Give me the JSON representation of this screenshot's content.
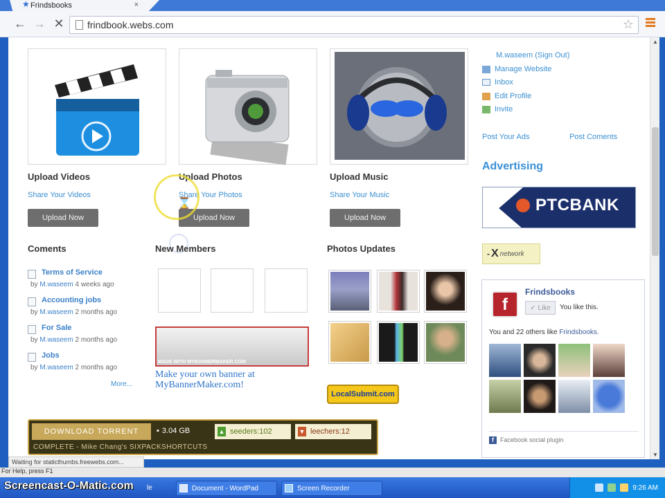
{
  "browser": {
    "tab_title": "Frindsbooks",
    "tab_close": "×",
    "url": "frindbook.webs.com",
    "back_glyph": "←",
    "forward_glyph": "→",
    "reload_glyph": "✕",
    "bookmark_glyph": "☆",
    "status_text": "Waiting for staticthumbs.freewebs.com..."
  },
  "uploads": [
    {
      "title": "Upload Videos",
      "share": "Share Your Videos",
      "button": "Upload Now",
      "icon": "clapperboard-icon"
    },
    {
      "title": "Upload Photos",
      "share": "Share Your Photos",
      "button": "Upload Now",
      "icon": "camera-icon"
    },
    {
      "title": "Upload Music",
      "share": "Share Your Music",
      "button": "Upload Now",
      "icon": "headphones-icon"
    }
  ],
  "user_menu": {
    "user": "M.waseem",
    "sign_out": "(Sign Out)",
    "items": [
      "Manage Website",
      "Inbox",
      "Edit Profile",
      "Invite"
    ],
    "post_ads": "Post Your Ads",
    "post_comments": "Post Coments"
  },
  "advertising": {
    "heading": "Advertising",
    "banner_text": "PTCBANK",
    "network_text": "network"
  },
  "comments": {
    "heading": "Coments",
    "items": [
      {
        "title": "Terms of Service",
        "by": "by",
        "author": "M.waseem",
        "when": "4 weeks ago"
      },
      {
        "title": "Accounting jobs",
        "by": "by",
        "author": "M.waseem",
        "when": "2 months ago"
      },
      {
        "title": "For Sale",
        "by": "by",
        "author": "M.waseem",
        "when": "2 months ago"
      },
      {
        "title": "Jobs",
        "by": "by",
        "author": "M.waseem",
        "when": "2 months ago"
      }
    ],
    "more": "More..."
  },
  "new_members": {
    "heading": "New Members",
    "banner_caption": "MADE WITH MYBANNERMAKER.COM",
    "banner_link_line1": "Make your own banner at",
    "banner_link_line2": "MyBannerMaker.com!"
  },
  "photos_updates": {
    "heading": "Photos Updates",
    "badge": "LocalSubmit.com"
  },
  "facebook": {
    "page_name": "Frindsbooks",
    "like_button": "Like",
    "you_like": "You like this.",
    "others_prefix": "You and 22 others like",
    "others_link": "Frindsbooks.",
    "plugin_label": "Facebook social plugin"
  },
  "torrent": {
    "button": "DOWNLOAD TORRENT",
    "size": "3.04 GB",
    "seeders_label": "seeders:",
    "seeders_value": "102",
    "leechers_label": "leechers:",
    "leechers_value": "12",
    "title": "COMPLETE - Mike Chang's SIXPACKSHORTCUTS"
  },
  "help_text": "For Help, press F1",
  "taskbar": {
    "watermark": "Screencast-O-Matic.com",
    "partial_task": "le",
    "tasks": [
      "Document - WordPad",
      "Screen Recorder"
    ],
    "clock": "9:26 AM"
  },
  "colors": {
    "link_blue": "#3b8fd1",
    "advertising_blue": "#3a8fd6",
    "ptc_navy": "#1b2f6b",
    "button_gray": "#6e6e6e"
  }
}
